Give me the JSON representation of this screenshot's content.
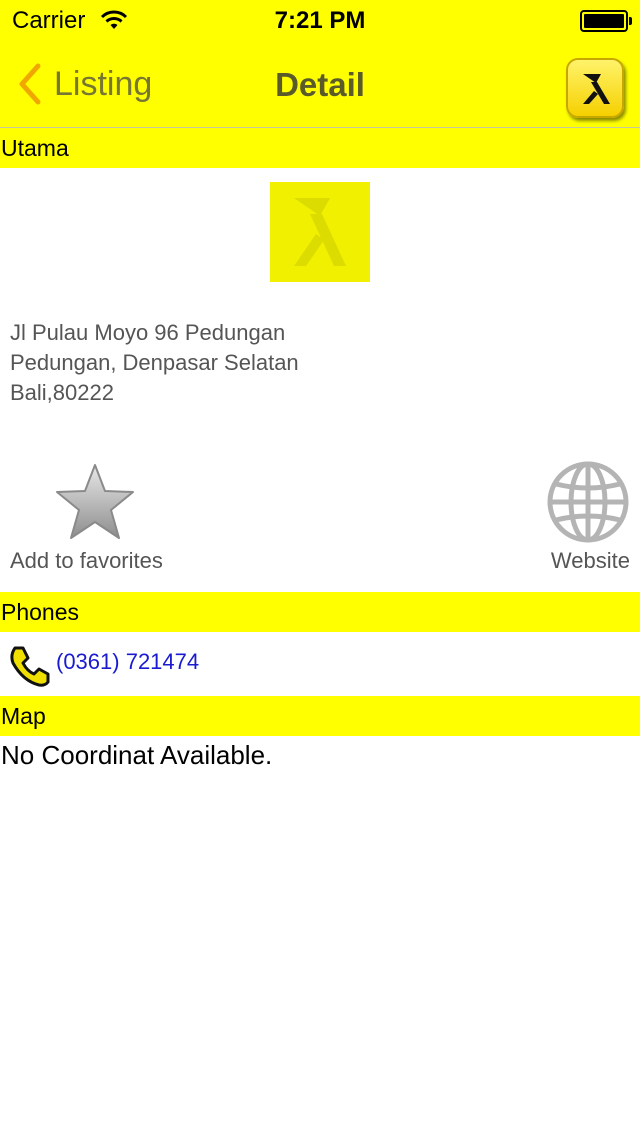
{
  "status_bar": {
    "carrier": "Carrier",
    "time": "7:21 PM",
    "battery_level": 1.0
  },
  "nav": {
    "back_label": "Listing",
    "title": "Detail",
    "logo_icon": "yellow-pages-icon"
  },
  "sections": {
    "main": "Utama",
    "phones": "Phones",
    "map": "Map"
  },
  "listing": {
    "address_line1": "Jl Pulau Moyo 96 Pedungan",
    "address_line2": "Pedungan, Denpasar Selatan",
    "address_line3": "Bali,80222"
  },
  "actions": {
    "favorite_label": "Add to favorites",
    "favorite_icon": "star-icon",
    "website_label": "Website",
    "website_icon": "globe-icon"
  },
  "phones": [
    {
      "number": "(0361) 721474"
    }
  ],
  "map": {
    "message": "No Coordinat Available."
  },
  "colors": {
    "accent": "#ffff00",
    "link": "#1a1ad0",
    "back_chevron": "#f0a800"
  }
}
